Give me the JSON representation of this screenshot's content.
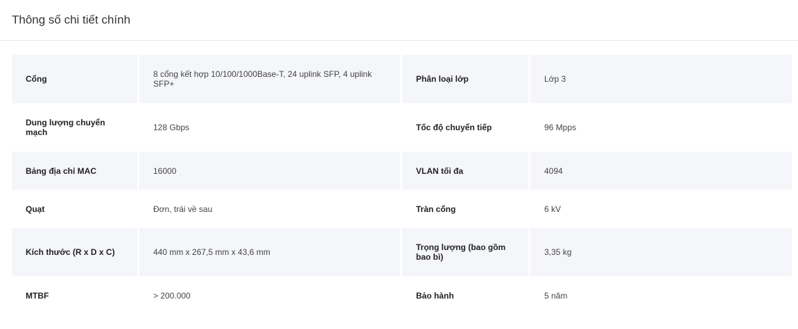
{
  "section_title": "Thông số chi tiết chính",
  "rows": [
    {
      "k1": "Cổng",
      "v1": "8 cổng kết hợp 10/100/1000Base-T, 24 uplink SFP, 4 uplink SFP+",
      "k2": "Phân loại lớp",
      "v2": "Lớp 3"
    },
    {
      "k1": "Dung lượng chuyển mạch",
      "v1": "128 Gbps",
      "k2": "Tốc độ chuyển tiếp",
      "v2": "96 Mpps"
    },
    {
      "k1": "Bảng địa chỉ MAC",
      "v1": "16000",
      "k2": "VLAN tối đa",
      "v2": "4094"
    },
    {
      "k1": "Quạt",
      "v1": "Đơn, trái về sau",
      "k2": "Tràn cổng",
      "v2": "6 kV"
    },
    {
      "k1": "Kích thước (R x D x C)",
      "v1": "440 mm x 267,5 mm x 43,6 mm",
      "k2": "Trọng lượng (bao gồm bao bì)",
      "v2": "3,35 kg"
    },
    {
      "k1": "MTBF",
      "v1": "> 200.000",
      "k2": "Bảo hành",
      "v2": "5 năm"
    }
  ]
}
